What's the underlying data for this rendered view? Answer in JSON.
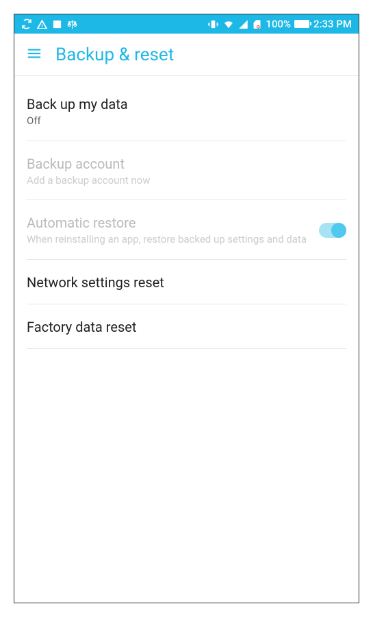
{
  "status_bar": {
    "battery_percent": "100%",
    "time": "2:33 PM"
  },
  "header": {
    "title": "Backup & reset"
  },
  "settings": [
    {
      "title": "Back up my data",
      "subtitle": "Off",
      "disabled": false,
      "has_toggle": false
    },
    {
      "title": "Backup account",
      "subtitle": "Add a backup account now",
      "disabled": true,
      "has_toggle": false
    },
    {
      "title": "Automatic restore",
      "subtitle": "When reinstalling an app, restore backed up settings and data",
      "disabled": true,
      "has_toggle": true,
      "toggle_on": true
    },
    {
      "title": "Network settings reset",
      "subtitle": "",
      "disabled": false,
      "has_toggle": false
    },
    {
      "title": "Factory data reset",
      "subtitle": "",
      "disabled": false,
      "has_toggle": false
    }
  ]
}
